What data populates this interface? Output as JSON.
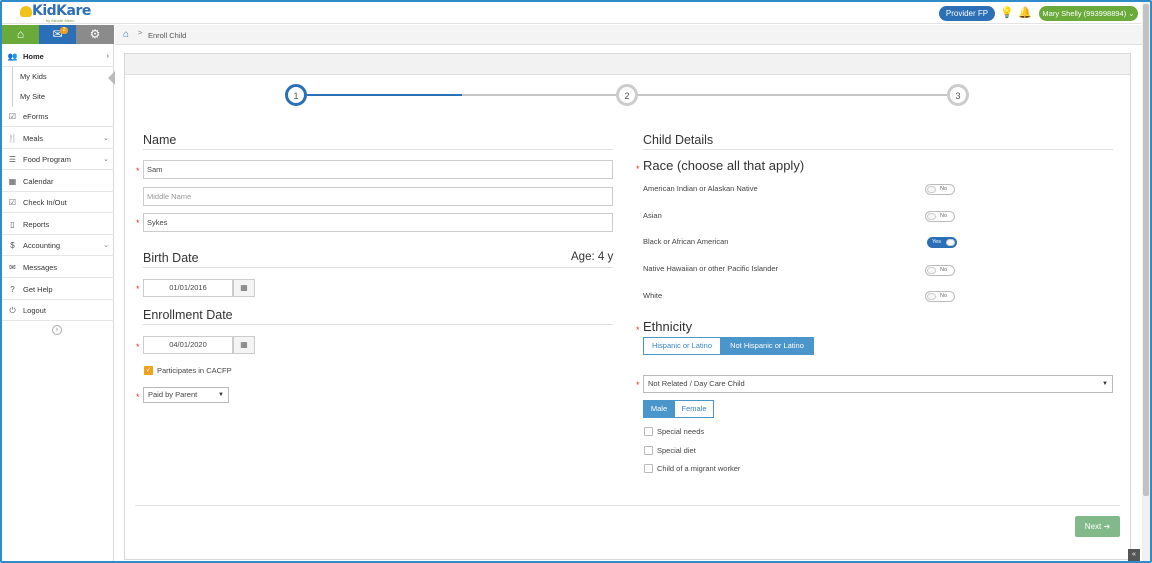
{
  "header": {
    "logo_text": "KidKare",
    "logo_sub": "by Minute Menu",
    "provider_button": "Provider FP",
    "user_button": "Mary Shelly (993998894)"
  },
  "sidebar": {
    "mail_badge": "2",
    "items": [
      {
        "label": "Home",
        "icon": "users-icon"
      },
      {
        "label": "eForms",
        "icon": "checkbox-icon"
      },
      {
        "label": "Meals",
        "icon": "utensils-icon"
      },
      {
        "label": "Food Program",
        "icon": "list-icon"
      },
      {
        "label": "Calendar",
        "icon": "calendar-icon"
      },
      {
        "label": "Check In/Out",
        "icon": "check-icon"
      },
      {
        "label": "Reports",
        "icon": "document-icon"
      },
      {
        "label": "Accounting",
        "icon": "dollar-icon"
      },
      {
        "label": "Messages",
        "icon": "envelope-icon"
      },
      {
        "label": "Get Help",
        "icon": "question-icon"
      },
      {
        "label": "Logout",
        "icon": "power-icon"
      }
    ],
    "subitems": [
      "My Kids",
      "My Site"
    ]
  },
  "breadcrumb": {
    "current": "Enroll Child"
  },
  "steps": [
    "1",
    "2",
    "3"
  ],
  "name_section": {
    "title": "Name",
    "first_name": "Sam",
    "middle_placeholder": "Middle Name",
    "last_name": "Sykes"
  },
  "birth_section": {
    "title": "Birth Date",
    "age": "Age: 4 y",
    "date": "01/01/2016"
  },
  "enroll_section": {
    "title": "Enrollment Date",
    "date": "04/01/2020",
    "cacfp_label": "Participates in CACFP",
    "cacfp_checked": true,
    "payment": "Paid by Parent"
  },
  "child_details": {
    "title": "Child Details",
    "race_title": "Race (choose all that apply)",
    "races": [
      {
        "label": "American Indian or Alaskan Native",
        "value": "No"
      },
      {
        "label": "Asian",
        "value": "No"
      },
      {
        "label": "Black or African American",
        "value": "Yes"
      },
      {
        "label": "Native Hawaiian or other Pacific Islander",
        "value": "No"
      },
      {
        "label": "White",
        "value": "No"
      }
    ],
    "ethnicity_title": "Ethnicity",
    "ethnicity_options": [
      "Hispanic or Latino",
      "Not Hispanic or Latino"
    ],
    "ethnicity_selected": "Not Hispanic or Latino",
    "relation": "Not Related / Day Care Child",
    "gender_options": [
      "Male",
      "Female"
    ],
    "gender_selected": "Male",
    "checkboxes": [
      "Special needs",
      "Special diet",
      "Child of a migrant worker"
    ]
  },
  "footer": {
    "next_label": "Next"
  },
  "colors": {
    "primary": "#2b6fb6",
    "green": "#6aaa3a",
    "orange": "#f2a01a"
  }
}
